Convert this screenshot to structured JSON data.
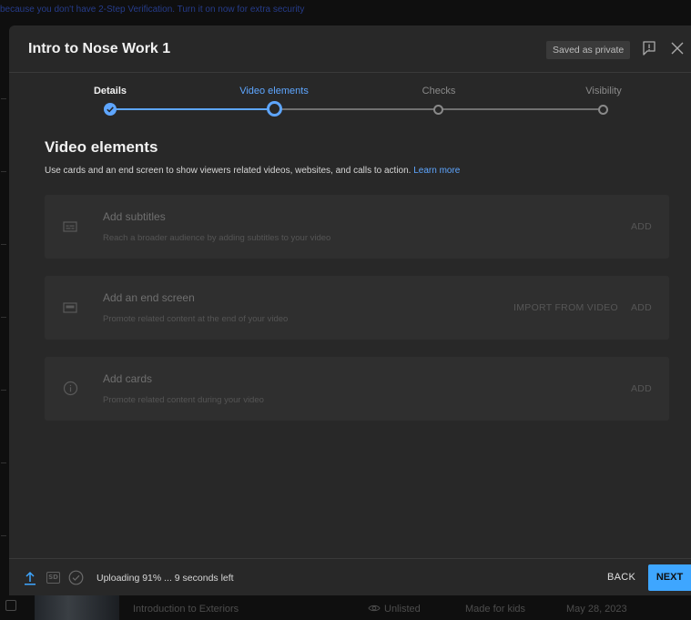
{
  "background": {
    "banner_text": "because you don't have 2-Step Verification. Turn it on now for extra security",
    "row": {
      "title": "Introduction to Exteriors",
      "visibility": "Unlisted",
      "audience": "Made for kids",
      "date": "May 28, 2023"
    }
  },
  "modal": {
    "title": "Intro to Nose Work 1",
    "saved_badge": "Saved as private",
    "steps": [
      {
        "label": "Details",
        "state": "done"
      },
      {
        "label": "Video elements",
        "state": "current"
      },
      {
        "label": "Checks",
        "state": "todo"
      },
      {
        "label": "Visibility",
        "state": "todo"
      }
    ],
    "section": {
      "title": "Video elements",
      "description": "Use cards and an end screen to show viewers related videos, websites, and calls to action.",
      "learn_more": "Learn more"
    },
    "cards": [
      {
        "icon": "subtitles-icon",
        "title": "Add subtitles",
        "subtitle": "Reach a broader audience by adding subtitles to your video",
        "import_label": "",
        "add_label": "ADD"
      },
      {
        "icon": "end-screen-icon",
        "title": "Add an end screen",
        "subtitle": "Promote related content at the end of your video",
        "import_label": "IMPORT FROM VIDEO",
        "add_label": "ADD"
      },
      {
        "icon": "info-icon",
        "title": "Add cards",
        "subtitle": "Promote related content during your video",
        "import_label": "",
        "add_label": "ADD"
      }
    ],
    "footer": {
      "sd_badge": "SD",
      "upload_progress": 91,
      "upload_status": "Uploading 91% ... 9 seconds left",
      "back_label": "BACK",
      "next_label": "NEXT"
    }
  },
  "colors": {
    "accent": "#3ea6ff",
    "step_done": "#5ea6ff",
    "step_todo": "#717171",
    "modal_bg": "#282828",
    "card_bg": "#2f2f2f"
  }
}
